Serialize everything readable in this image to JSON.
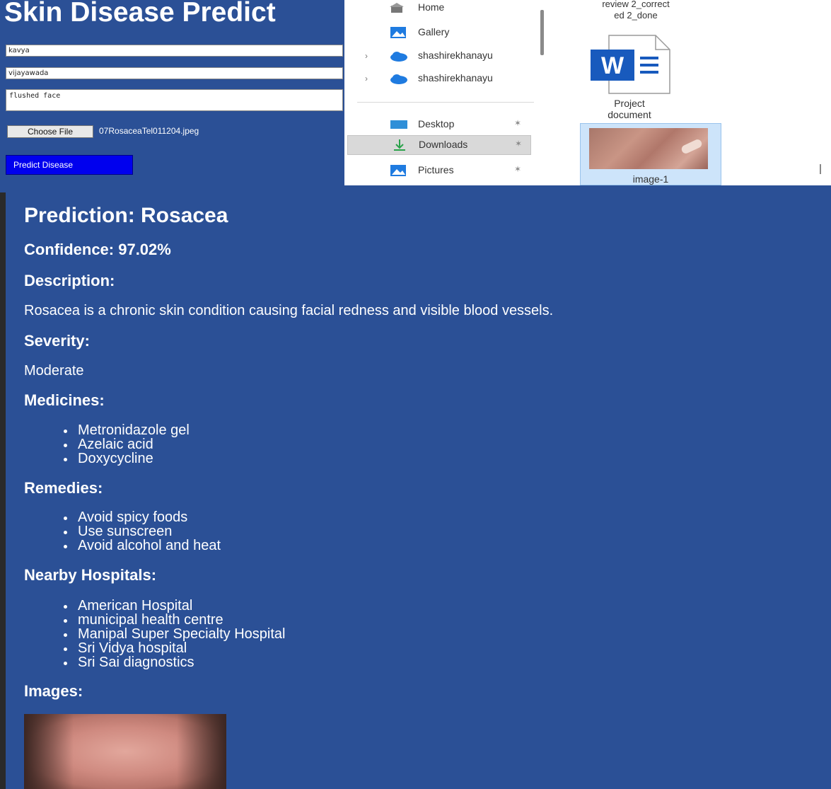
{
  "form": {
    "title": "Skin Disease Predict",
    "name_value": "kavya",
    "location_value": "vijayawada",
    "symptoms_value": "flushed face",
    "choose_file_label": "Choose File",
    "file_name": "07RosaceaTel011204.jpeg",
    "predict_button_label": "Predict Disease"
  },
  "explorer": {
    "nav_items": [
      {
        "label": "Home",
        "icon": "home-icon"
      },
      {
        "label": "Gallery",
        "icon": "gallery-icon"
      },
      {
        "label": "shashirekhanayu",
        "icon": "onedrive-cloud-icon"
      },
      {
        "label": "shashirekhanayu",
        "icon": "onedrive-cloud-icon"
      },
      {
        "label": "Desktop",
        "icon": "desktop-icon"
      },
      {
        "label": "Downloads",
        "icon": "download-arrow-icon"
      },
      {
        "label": "Pictures",
        "icon": "pictures-icon"
      }
    ],
    "files": {
      "prev_file_line1": "review 2_correct",
      "prev_file_line2": "ed 2_done",
      "doc_caption_line1": "Project",
      "doc_caption_line2": "document",
      "image_caption": "image-1"
    },
    "colors": {
      "word_blue": "#185abd",
      "onedrive_blue": "#1f7be0",
      "selected_bg": "#d9d9d9"
    }
  },
  "result": {
    "prediction": "Prediction: Rosacea",
    "confidence": "Confidence: 97.02%",
    "description_heading": "Description:",
    "description_text": "Rosacea is a chronic skin condition causing facial redness and visible blood vessels.",
    "severity_heading": "Severity:",
    "severity_text": "Moderate",
    "medicines_heading": "Medicines:",
    "medicines": [
      "Metronidazole gel",
      "Azelaic acid",
      "Doxycycline"
    ],
    "remedies_heading": "Remedies:",
    "remedies": [
      "Avoid spicy foods",
      "Use sunscreen",
      "Avoid alcohol and heat"
    ],
    "hospitals_heading": "Nearby Hospitals:",
    "hospitals": [
      "American Hospital",
      "municipal health centre",
      "Manipal Super Specialty Hospital",
      "Sri Vidya hospital",
      "Sri Sai diagnostics"
    ],
    "images_heading": "Images:",
    "colors": {
      "panel_bg": "#2b5096",
      "text": "#ffffff"
    }
  }
}
